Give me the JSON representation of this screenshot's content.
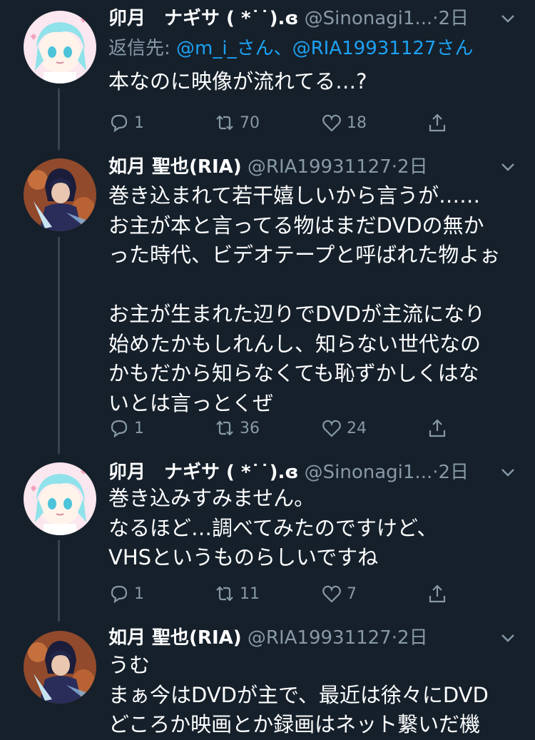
{
  "tweets": [
    {
      "name": "卯月　ナギサ ( *˙˙).ɞ",
      "handle": "@Sinonagi1...",
      "dot": "·",
      "time": "2日",
      "reply_prefix": "返信先: ",
      "reply_mention1": "@m_i_さん",
      "reply_sep": "、",
      "reply_mention2": "@RIA19931127さん",
      "text": "本なのに映像が流れてる…?",
      "replies": "1",
      "retweets": "70",
      "likes": "18"
    },
    {
      "name": "如月 聖也(RIA)",
      "handle": "@RIA19931127",
      "dot": "·",
      "time": "2日",
      "text": "巻き込まれて若干嬉しいから言うが……\nお主が本と言ってる物はまだDVDの無か\nった時代、ビデオテープと呼ばれた物よぉ\n\nお主が生まれた辺りでDVDが主流になり\n始めたかもしれんし、知らない世代なの\nかもだから知らなくても恥ずかしくはな\nいとは言っとくぜ",
      "replies": "1",
      "retweets": "36",
      "likes": "24"
    },
    {
      "name": "卯月　ナギサ ( *˙˙).ɞ",
      "handle": "@Sinonagi1...",
      "dot": "·",
      "time": "2日",
      "text": "巻き込みすみません。\nなるほど…調べてみたのですけど、\nVHSというものらしいですね",
      "replies": "1",
      "retweets": "11",
      "likes": "7"
    },
    {
      "name": "如月 聖也(RIA)",
      "handle": "@RIA19931127",
      "dot": "·",
      "time": "2日",
      "text": "うむ\nまぁ今はDVDが主で、最近は徐々にDVD\nどころか映画とか録画はネット繋いだ機"
    }
  ]
}
